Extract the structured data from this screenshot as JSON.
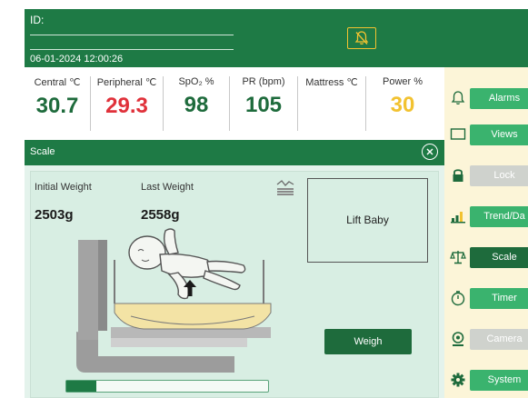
{
  "header": {
    "id_label": "ID:",
    "datetime": "06-01-2024  12:00:26",
    "alarm_icon": "bell-off-icon",
    "accent": "#1e7a45"
  },
  "vitals": [
    {
      "label": "Central ℃",
      "value": "30.7",
      "color": "#1e6b3c"
    },
    {
      "label": "Peripheral ℃",
      "value": "29.3",
      "color": "#e0313a"
    },
    {
      "label": "SpO₂ %",
      "value": "98",
      "color": "#1e6b3c"
    },
    {
      "label": "PR (bpm)",
      "value": "105",
      "color": "#1e6b3c"
    },
    {
      "label": "Mattress ℃",
      "value": "",
      "color": "#1e6b3c"
    },
    {
      "label": "Power %",
      "value": "30",
      "color": "#f2c230"
    }
  ],
  "sidebar": {
    "items": [
      {
        "label": "Alarms",
        "icon": "bell-icon",
        "state": "active"
      },
      {
        "label": "Views",
        "icon": "monitor-icon",
        "state": "active"
      },
      {
        "label": "Lock",
        "icon": "lock-icon",
        "state": "disabled"
      },
      {
        "label": "Trend/Da",
        "icon": "trend-icon",
        "state": "active"
      },
      {
        "label": "Scale",
        "icon": "scale-icon",
        "state": "selected"
      },
      {
        "label": "Timer",
        "icon": "timer-icon",
        "state": "active"
      },
      {
        "label": "Camera",
        "icon": "camera-icon",
        "state": "disabled"
      },
      {
        "label": "System",
        "icon": "gear-icon",
        "state": "active"
      }
    ]
  },
  "scale": {
    "title": "Scale",
    "initial_label": "Initial Weight",
    "initial_value": "2503g",
    "last_label": "Last Weight",
    "last_value": "2558g",
    "instruction": "Lift Baby",
    "weigh_label": "Weigh",
    "progress": 0.15
  }
}
